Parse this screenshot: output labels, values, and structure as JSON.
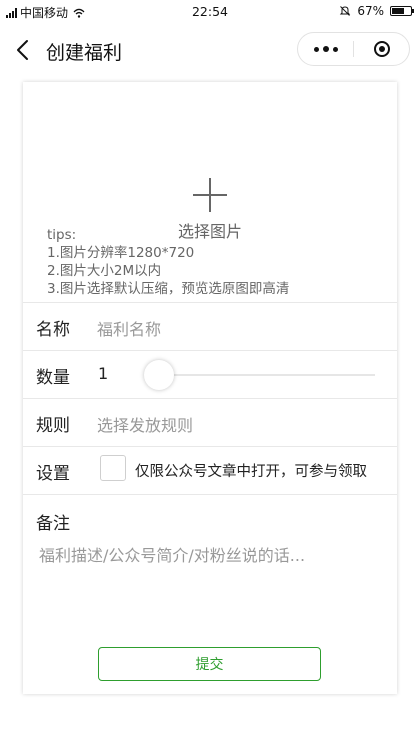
{
  "status_bar": {
    "carrier": "中国移动",
    "time": "22:54",
    "battery": "67%",
    "battery_level": 0.67
  },
  "nav": {
    "title": "创建福利"
  },
  "upload": {
    "label": "选择图片",
    "tips_title": "tips:",
    "tips": [
      "1.图片分辨率1280*720",
      "2.图片大小2M以内",
      "3.图片选择默认压缩，预览选原图即高清"
    ]
  },
  "form": {
    "name_label": "名称",
    "name_placeholder": "福利名称",
    "qty_label": "数量",
    "qty_value": "1",
    "rule_label": "规则",
    "rule_placeholder": "选择发放规则",
    "settings_label": "设置",
    "settings_option": "仅限公众号文章中打开，可参与领取",
    "remark_label": "备注",
    "remark_placeholder": "福利描述/公众号简介/对粉丝说的话..."
  },
  "submit": {
    "label": "提交"
  },
  "colors": {
    "accent": "#2e9e2e",
    "placeholder": "#999999"
  }
}
